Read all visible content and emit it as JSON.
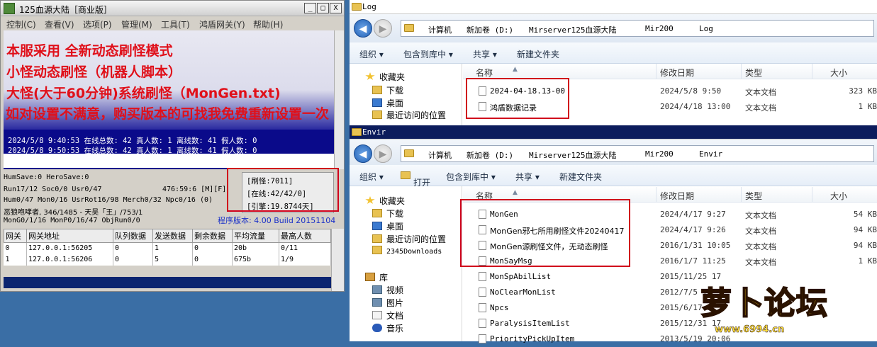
{
  "server_window": {
    "title": "125血源大陆［商业版］",
    "buttons": {
      "min": "_",
      "max": "□",
      "close": "X"
    },
    "menu": [
      "控制(C)",
      "查看(V)",
      "选项(P)",
      "管理(M)",
      "工具(T)",
      "鸿盾网关(Y)",
      "帮助(H)"
    ],
    "log_lines": [
      "2024/5/8 9:40:53 在线总数: 42 真人数: 1 离线数: 41 假人数: 0",
      "2024/5/8 9:50:53 在线总数: 42 真人数: 1 离线数: 41 假人数: 0"
    ],
    "status_lines": [
      "HumSave:0 HeroSave:0",
      "Run17/12 Soc0/0 Usr0/47",
      "Hum0/47 Mon0/16 UsrRot16/98 Merch0/32 Npc0/16 (0)",
      "恶狼咆哮者, 346/1485 - 天吴「王」/753/1",
      "MonG0/1/16 MonP0/16/47 ObjRun0/0"
    ],
    "coords": "476:59:6 [M][F]",
    "stats": [
      "[刷怪:7011]",
      "[在线:42/42/0]",
      "[引擎:19.8744天]"
    ],
    "version": "程序版本: 4.00 Build 20151104",
    "table": {
      "headers": [
        "网关",
        "网关地址",
        "队列数据",
        "发送数据",
        "剩余数据",
        "平均流量",
        "最高人数"
      ],
      "rows": [
        [
          "0",
          "127.0.0.1:56205",
          "0",
          "1",
          "0",
          "20b",
          "0/11"
        ],
        [
          "1",
          "127.0.0.1:56206",
          "0",
          "5",
          "0",
          "675b",
          "1/9"
        ]
      ]
    }
  },
  "promo_lines": [
    "本服采用 全新动态刷怪模式",
    "小怪动态刷怪（机器人脚本）",
    "大怪(大于60分钟)系统刷怪（MonGen.txt)",
    "如对设置不满意，购买版本的可找我免费重新设置一次"
  ],
  "log_window": {
    "title": "Log",
    "back": "◀",
    "forward": "▶",
    "breadcrumb": [
      "计算机",
      "新加卷 (D:)",
      "Mirserver125血源大陆",
      "Mir200",
      "Log"
    ],
    "toolbar": [
      "组织 ▾",
      "包含到库中 ▾",
      "共享 ▾",
      "新建文件夹"
    ],
    "nav": [
      "收藏夹",
      "下载",
      "桌面",
      "最近访问的位置"
    ],
    "headers": [
      "名称",
      "修改日期",
      "类型",
      "大小"
    ],
    "files": [
      {
        "name": "2024-04-18.13-00",
        "date": "2024/5/8 9:50",
        "type": "文本文档",
        "size": "323 KB"
      },
      {
        "name": "鸿盾数据记录",
        "date": "2024/4/18 13:00",
        "type": "文本文档",
        "size": "1 KB"
      }
    ]
  },
  "envir_window": {
    "title": "Envir",
    "back": "◀",
    "forward": "▶",
    "breadcrumb": [
      "计算机",
      "新加卷 (D:)",
      "Mirserver125血源大陆",
      "Mir200",
      "Envir"
    ],
    "toolbar": [
      "组织 ▾",
      "打开",
      "包含到库中 ▾",
      "共享 ▾",
      "新建文件夹"
    ],
    "nav": [
      "收藏夹",
      "下载",
      "桌面",
      "最近访问的位置",
      "2345Downloads",
      "库",
      "视频",
      "图片",
      "文档",
      "音乐"
    ],
    "headers": [
      "名称",
      "修改日期",
      "类型",
      "大小"
    ],
    "files": [
      {
        "name": "MonGen",
        "date": "2024/4/17 9:27",
        "type": "文本文档",
        "size": "54 KB"
      },
      {
        "name": "MonGen邪七所用刷怪文件20240417",
        "date": "2024/4/17 9:26",
        "type": "文本文档",
        "size": "94 KB"
      },
      {
        "name": "MonGen源刷怪文件，无动态刷怪",
        "date": "2016/1/31 10:05",
        "type": "文本文档",
        "size": "94 KB"
      },
      {
        "name": "MonSayMsg",
        "date": "2016/1/7 11:25",
        "type": "文本文档",
        "size": "1 KB"
      },
      {
        "name": "MonSpAbilList",
        "date": "2015/11/25 17",
        "type": "",
        "size": ""
      },
      {
        "name": "NoClearMonList",
        "date": "2012/7/5 18",
        "type": "",
        "size": ""
      },
      {
        "name": "Npcs",
        "date": "2015/6/17 0",
        "type": "",
        "size": ""
      },
      {
        "name": "ParalysisItemList",
        "date": "2015/12/31 17",
        "type": "",
        "size": ""
      },
      {
        "name": "PriorityPickUpItem",
        "date": "2013/5/19 20:06",
        "type": "",
        "size": ""
      }
    ]
  },
  "watermark": {
    "main": "萝卜论坛",
    "site": "www.6994.cn"
  }
}
